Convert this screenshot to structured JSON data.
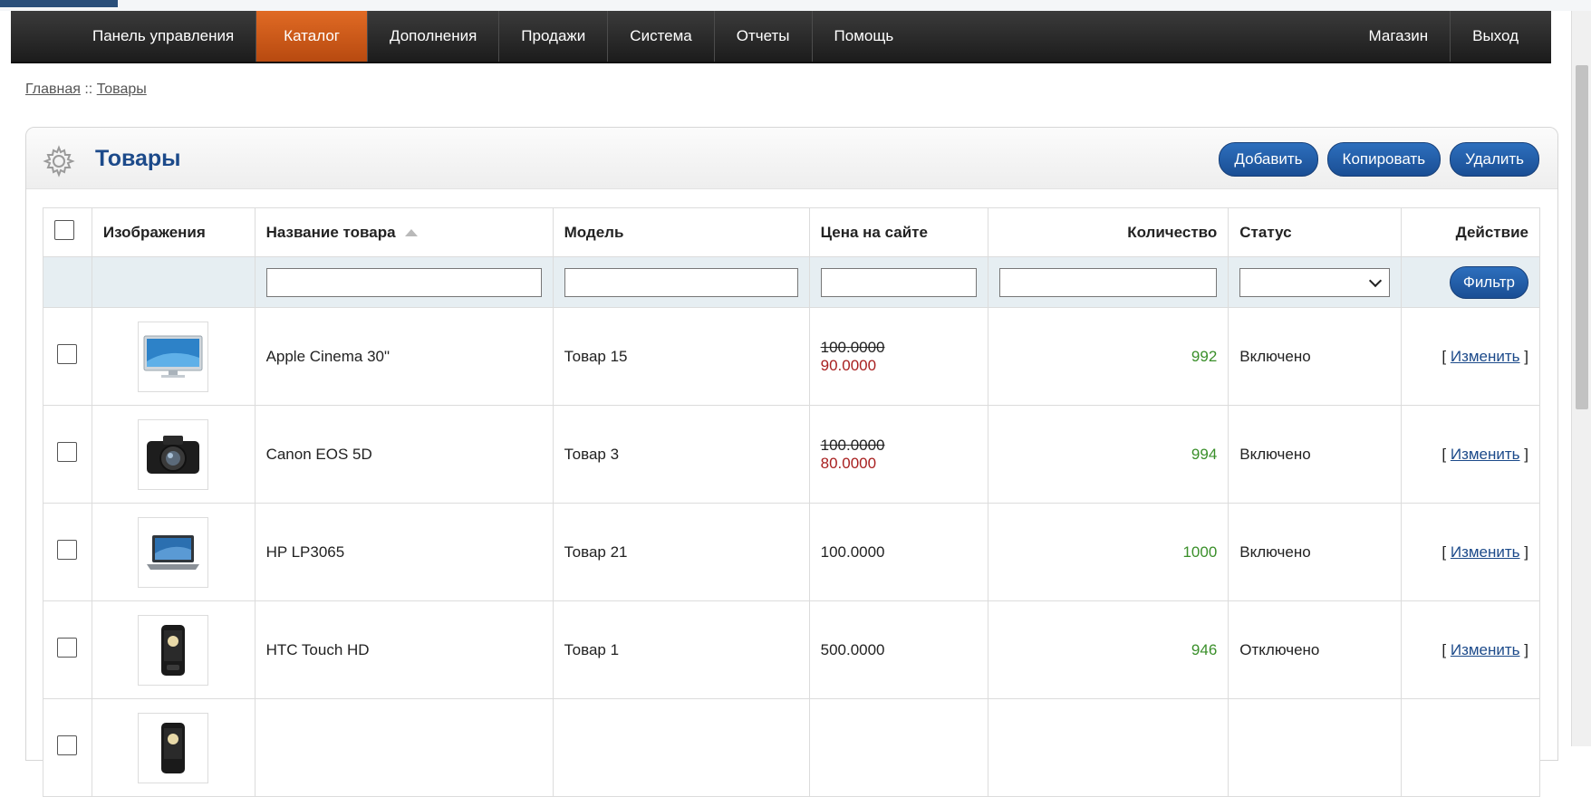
{
  "navbar": {
    "items": [
      "Панель управления",
      "Каталог",
      "Дополнения",
      "Продажи",
      "Система",
      "Отчеты",
      "Помощь"
    ],
    "right_items": [
      "Магазин",
      "Выход"
    ],
    "active": "Каталог"
  },
  "breadcrumb": {
    "home": "Главная",
    "separator": "::",
    "current": "Товары"
  },
  "panel": {
    "title": "Товары",
    "buttons": {
      "add": "Добавить",
      "copy": "Копировать",
      "delete": "Удалить"
    }
  },
  "table": {
    "headers": {
      "image": "Изображения",
      "name": "Название товара",
      "model": "Модель",
      "price": "Цена на сайте",
      "quantity": "Количество",
      "status": "Статус",
      "action": "Действие"
    },
    "filter_button": "Фильтр",
    "rows": [
      {
        "name": "Apple Cinema 30\"",
        "model": "Товар 15",
        "price_old": "100.0000",
        "price_new": "90.0000",
        "quantity": "992",
        "status": "Включено",
        "edit": "Изменить",
        "image_icon": "monitor-icon"
      },
      {
        "name": "Canon EOS 5D",
        "model": "Товар 3",
        "price_old": "100.0000",
        "price_new": "80.0000",
        "quantity": "994",
        "status": "Включено",
        "edit": "Изменить",
        "image_icon": "camera-icon"
      },
      {
        "name": "HP LP3065",
        "model": "Товар 21",
        "price": "100.0000",
        "quantity": "1000",
        "status": "Включено",
        "edit": "Изменить",
        "image_icon": "laptop-icon"
      },
      {
        "name": "HTC Touch HD",
        "model": "Товар 1",
        "price": "500.0000",
        "quantity": "946",
        "status": "Отключено",
        "edit": "Изменить",
        "image_icon": "phone-icon"
      }
    ]
  },
  "colors": {
    "nav_active": "#d35a17",
    "title_blue": "#1c4a8a",
    "button_blue": "#1f5aa6",
    "special_price": "#a82020",
    "quantity_green": "#3a8f2a"
  }
}
